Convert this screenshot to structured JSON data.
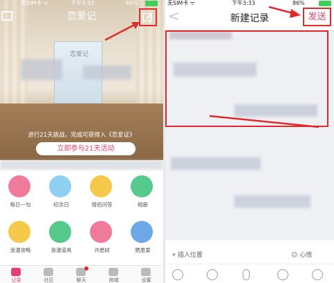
{
  "left": {
    "status": {
      "signal": "无SIM卡 ᯤ",
      "time": "下午3:33",
      "battery": "86%"
    },
    "title": "恋爱记",
    "banner_text": "进行21天挑战，完成可获得入《恋爱证》",
    "join_button": "立即参与21天活动",
    "box_logo": "恋爱记",
    "grid": [
      {
        "label": "每日一句",
        "color": "#f07a9a"
      },
      {
        "label": "纪念日",
        "color": "#8fd0f0"
      },
      {
        "label": "情侣问答",
        "color": "#f6c94a"
      },
      {
        "label": "相册",
        "color": "#56c98c"
      },
      {
        "label": "浪漫攻略",
        "color": "#f6c94a"
      },
      {
        "label": "浪漫道具",
        "color": "#56c98c"
      },
      {
        "label": "许愿树",
        "color": "#f07a9a"
      },
      {
        "label": "晒恩爱",
        "color": "#6fa8e6"
      }
    ],
    "tabs": [
      {
        "label": "记录",
        "active": true
      },
      {
        "label": "社区",
        "active": false
      },
      {
        "label": "聊天",
        "active": false,
        "badge": true
      },
      {
        "label": "商城",
        "active": false
      },
      {
        "label": "设置",
        "active": false
      }
    ]
  },
  "right": {
    "status": {
      "carrier": "无SIM卡 ᯤ",
      "time": "下午3:33",
      "battery": "86%"
    },
    "back": "<",
    "title": "新建记录",
    "send": "发送",
    "insert_location": "插入位置",
    "mood": "心情"
  },
  "colors": {
    "accent": "#e2416b",
    "annotation": "#e02a2a"
  }
}
